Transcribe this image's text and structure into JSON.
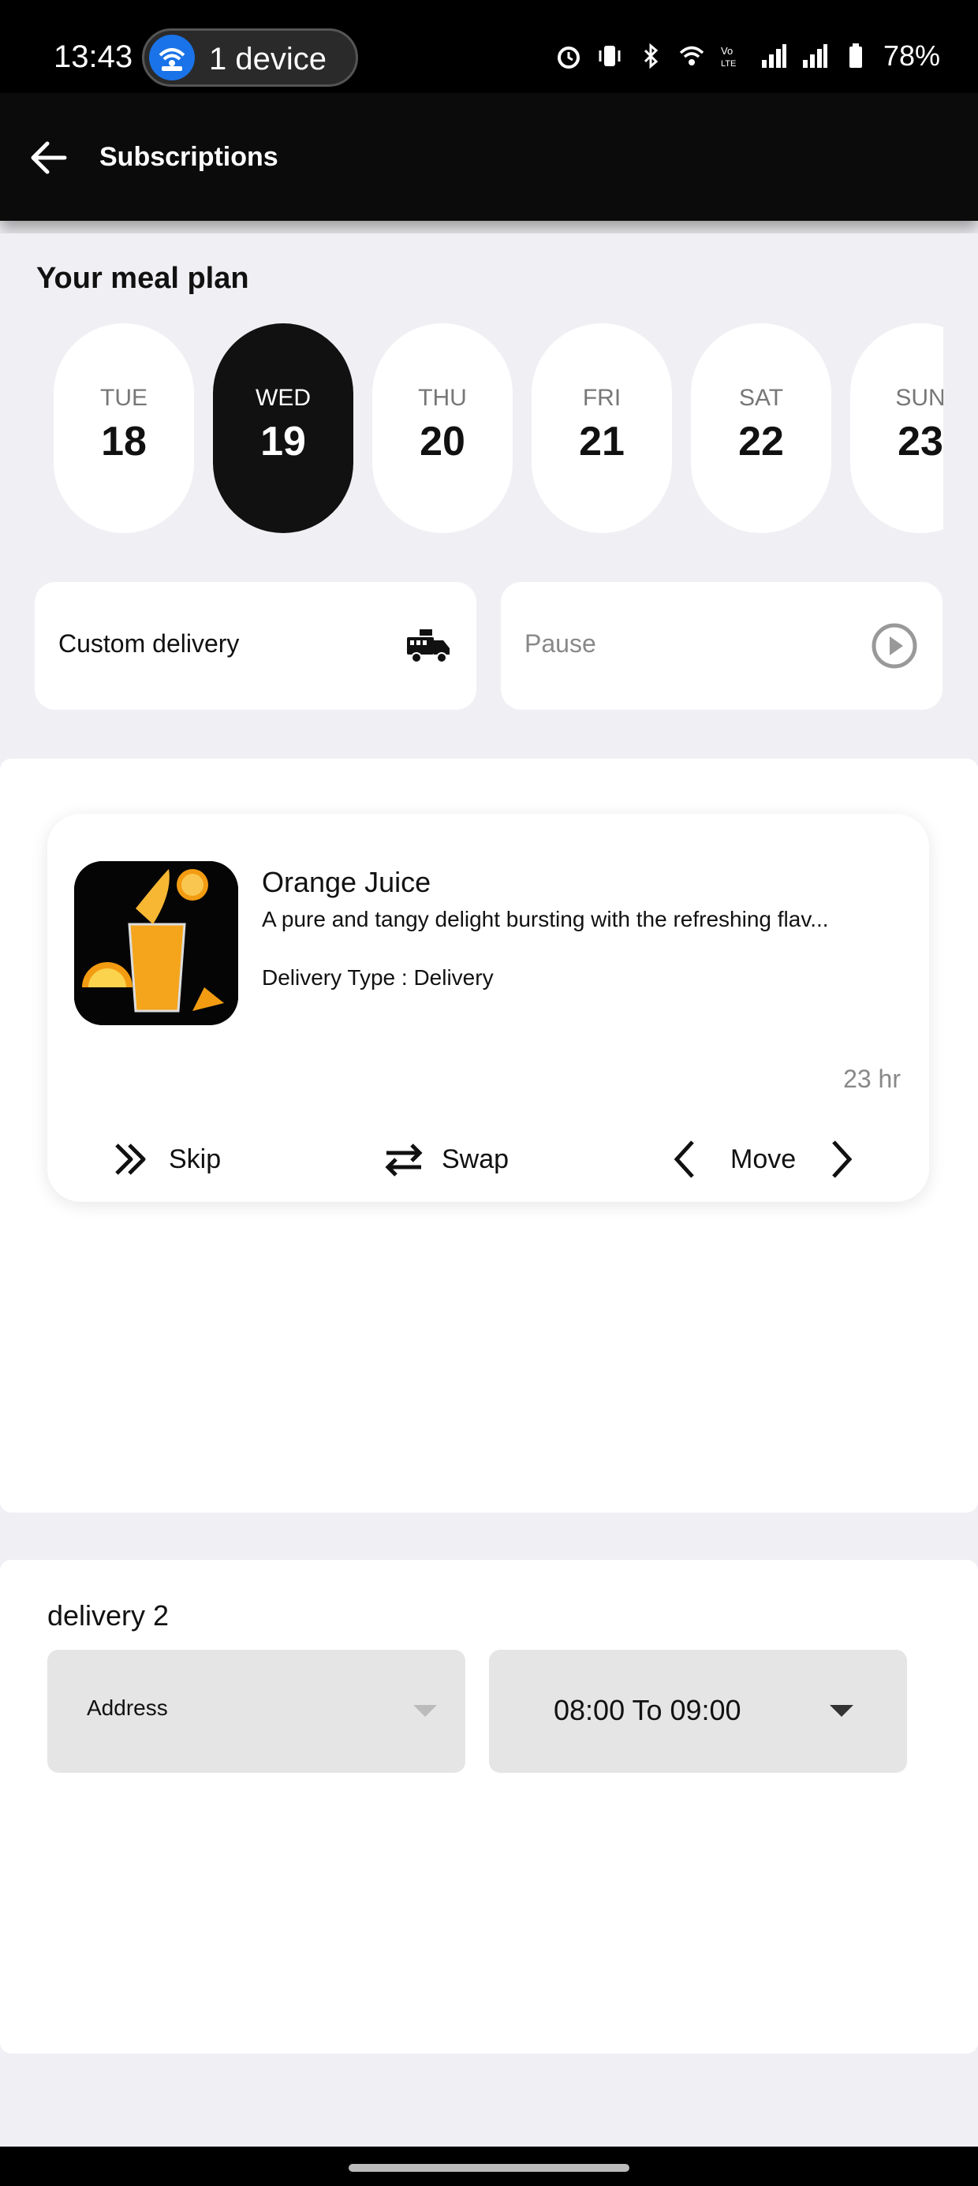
{
  "status_bar": {
    "time": "13:43",
    "hotspot_label": "1 device",
    "battery": "78%",
    "icons": [
      "alarm-icon",
      "vibrate-icon",
      "bluetooth-icon",
      "wifi-icon",
      "volte-icon",
      "signal-icon",
      "signal-icon",
      "battery-icon"
    ]
  },
  "app_bar": {
    "title": "Subscriptions",
    "back_icon": "arrow-left-icon"
  },
  "meal_plan": {
    "title": "Your meal plan",
    "days": [
      {
        "name": "TUE",
        "date": "18",
        "selected": false
      },
      {
        "name": "WED",
        "date": "19",
        "selected": true
      },
      {
        "name": "THU",
        "date": "20",
        "selected": false
      },
      {
        "name": "FRI",
        "date": "21",
        "selected": false
      },
      {
        "name": "SAT",
        "date": "22",
        "selected": false
      },
      {
        "name": "SUN",
        "date": "23",
        "selected": false
      }
    ],
    "custom_delivery_label": "Custom delivery",
    "custom_delivery_icon": "delivery-truck-icon",
    "pause_label": "Pause",
    "pause_icon": "play-circle-icon"
  },
  "meal_card": {
    "name": "Orange Juice",
    "description": "A pure and tangy delight bursting with the refreshing flav...",
    "delivery_type": "Delivery Type : Delivery",
    "time_remaining": "23 hr",
    "actions": {
      "skip": "Skip",
      "swap": "Swap",
      "move": "Move"
    }
  },
  "delivery": {
    "label": "delivery 2",
    "address_placeholder": "Address",
    "time_slot": "08:00 To 09:00"
  },
  "colors": {
    "selected_day": "#111111",
    "background": "#f0f0f4",
    "card": "#ffffff",
    "dropdown": "#e5e5e5"
  }
}
